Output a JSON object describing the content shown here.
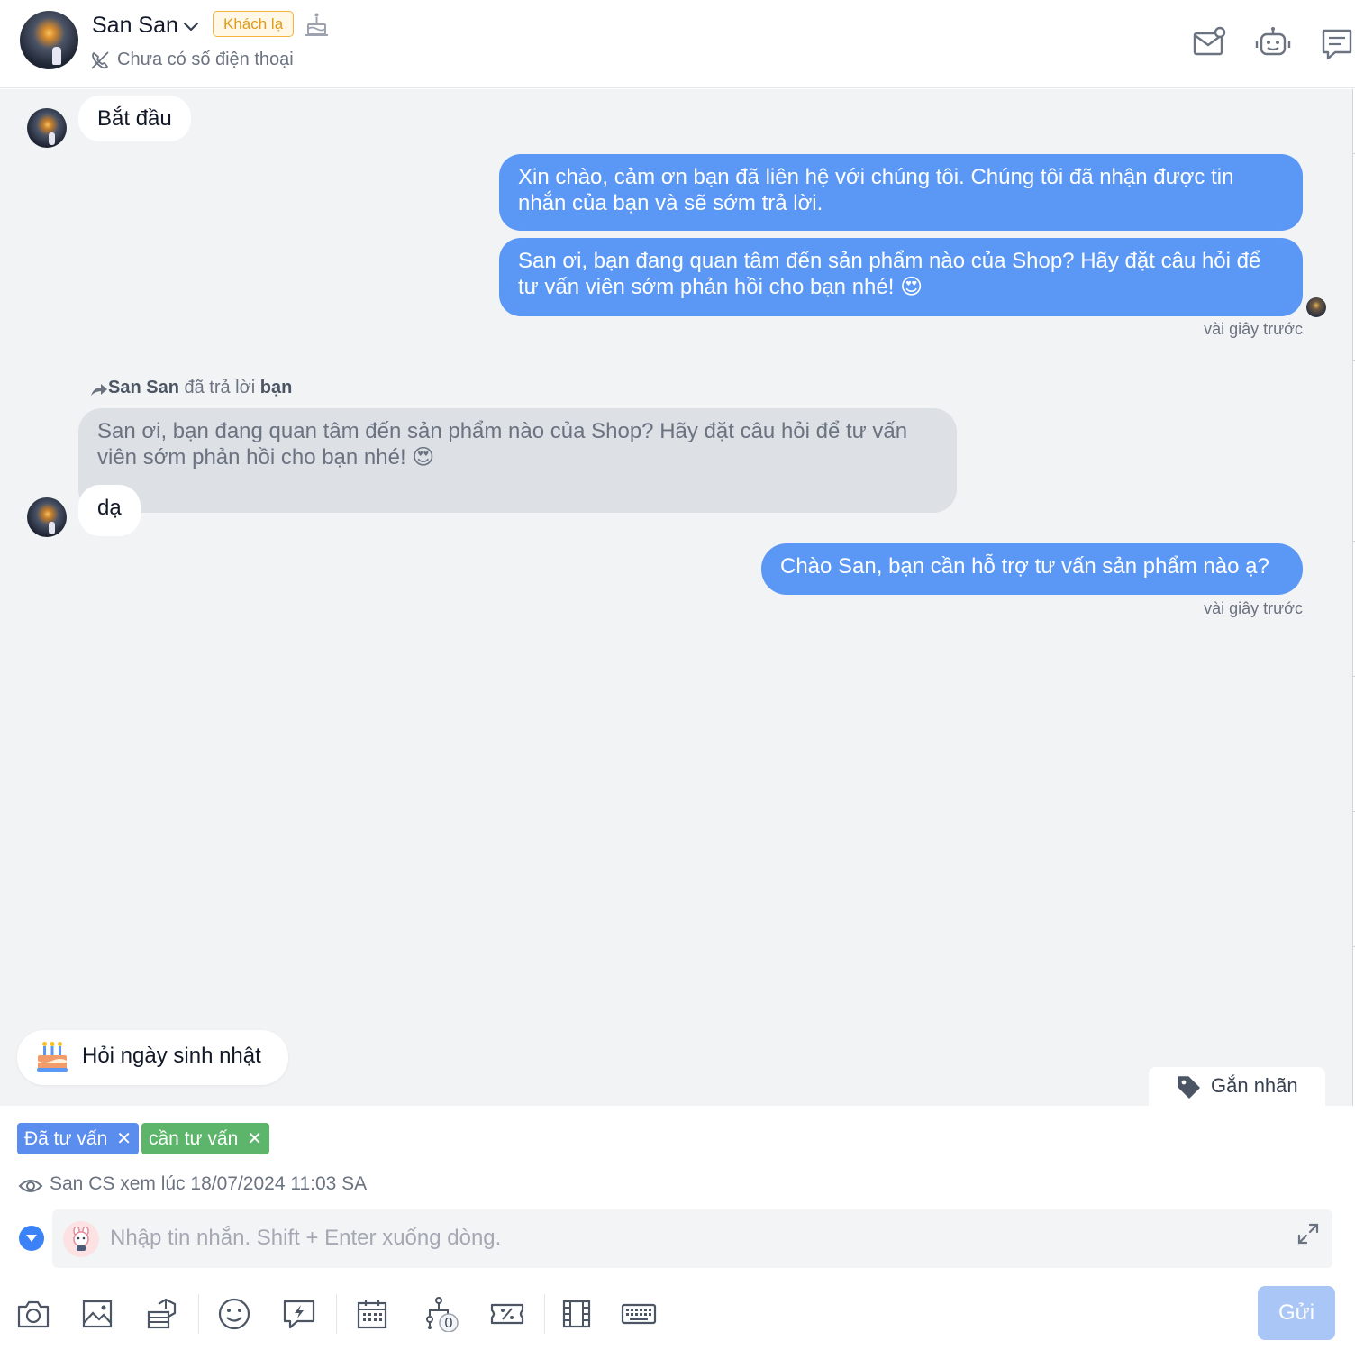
{
  "header": {
    "name": "San San",
    "badge": "Khách lạ",
    "phone": "Chưa có số điện thoại"
  },
  "messages": [
    {
      "side": "in",
      "text": "Bắt đầu"
    },
    {
      "side": "out",
      "text": "Xin chào, cảm ơn bạn đã liên hệ với chúng tôi. Chúng tôi đã nhận được tin nhắn của bạn và sẽ sớm trả lời."
    },
    {
      "side": "out",
      "text": "San ơi, bạn đang quan tâm đến sản phẩm nào của Shop? Hãy đặt câu hỏi để tư vấn viên sớm phản hồi cho bạn nhé! 😍"
    },
    {
      "side": "out",
      "time": "vài giây trước"
    },
    {
      "side": "in",
      "reply_name": "San San",
      "reply_mid": "đã trả lời",
      "reply_target": "bạn",
      "quoted": "San ơi, bạn đang quan tâm đến sản phẩm nào của Shop? Hãy đặt câu hỏi để tư vấn viên sớm phản hồi cho bạn nhé! 😍",
      "text": "dạ"
    },
    {
      "side": "out",
      "text": "Chào  San, bạn cần hỗ trợ tư vấn sản phẩm nào ạ?",
      "time": "vài giây trước"
    }
  ],
  "birthday_prompt": "Hỏi ngày sinh nhật",
  "tag_button": "Gắn nhãn",
  "labels": [
    {
      "text": "Đã tư vấn",
      "color": "#5b8def"
    },
    {
      "text": "cần tư vấn",
      "color": "#5cb56a"
    }
  ],
  "seen": "San CS xem lúc 18/07/2024 11:03 SA",
  "compose": {
    "placeholder": "Nhập tin nhắn. Shift + Enter xuống dòng."
  },
  "toolbar": {
    "flow_count": "0",
    "send_label": "Gửi",
    "tools": [
      "camera-icon",
      "image-icon",
      "product-icon",
      "emoji-icon",
      "quick-reply-icon",
      "calendar-icon",
      "flow-icon",
      "discount-icon",
      "video-icon",
      "keyboard-icon"
    ]
  },
  "colors": {
    "primary": "#5b98f5",
    "send_disabled": "#a9c6f7",
    "chat_bg": "#f2f3f5",
    "badge": "#f5b33c"
  }
}
